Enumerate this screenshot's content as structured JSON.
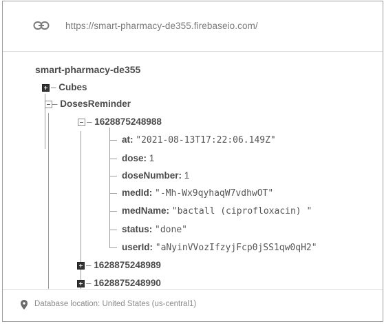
{
  "url_bar": {
    "icon": "link-icon",
    "url": "https://smart-pharmacy-de355.firebaseio.com/"
  },
  "tree": {
    "root": "smart-pharmacy-de355",
    "nodes": {
      "cubes": "Cubes",
      "doses_reminder": "DosesReminder",
      "entry_1": "1628875248988",
      "entry_2": "1628875248989",
      "entry_3": "1628875248990"
    },
    "fields": [
      {
        "key": "at",
        "value": "\"2021-08-13T17:22:06.149Z\""
      },
      {
        "key": "dose",
        "value": "1"
      },
      {
        "key": "doseNumber",
        "value": "1"
      },
      {
        "key": "medId",
        "value": "\"-Mh-Wx9qyhaqW7vdhwOT\""
      },
      {
        "key": "medName",
        "value": "\"bactall (ciprofloxacin) \""
      },
      {
        "key": "status",
        "value": "\"done\""
      },
      {
        "key": "userId",
        "value": "\"aNyinVVozIfzyjFcp0jSS1qw0qH2\""
      }
    ]
  },
  "footer": {
    "icon": "location-pin-icon",
    "text": "Database location: United States (us-central1)"
  },
  "colors": {
    "border": "#9a9a9a",
    "key_text": "#4a4a4a",
    "muted_text": "#8a8a8a"
  }
}
